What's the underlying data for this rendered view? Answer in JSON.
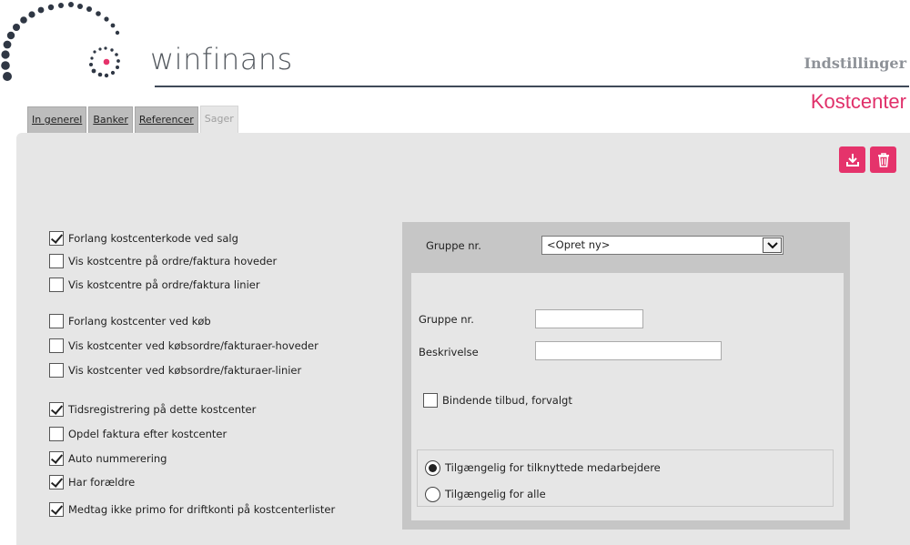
{
  "header": {
    "logo_text": "winfinans",
    "section_title": "Indstillinger",
    "page_title": "Kostcenter"
  },
  "tabs": [
    {
      "label": "In generel",
      "active": false
    },
    {
      "label": "Banker",
      "active": false
    },
    {
      "label": "Referencer",
      "active": false
    },
    {
      "label": "Sager",
      "active": true
    }
  ],
  "toolbar": {
    "save_icon": "download-icon",
    "delete_icon": "trash-icon"
  },
  "settings": [
    {
      "label": "Forlang kostcenterkode ved salg",
      "checked": true
    },
    {
      "label": "Vis kostcentre på ordre/faktura hoveder",
      "checked": false
    },
    {
      "label": "Vis kostcentre på ordre/faktura linier",
      "checked": false
    },
    {
      "label": "Forlang kostcenter ved køb",
      "checked": false
    },
    {
      "label": "Vis kostcenter ved købsordre/fakturaer-hoveder",
      "checked": false
    },
    {
      "label": "Vis kostcenter ved købsordre/fakturaer-linier",
      "checked": false
    },
    {
      "label": "Tidsregistrering på dette kostcenter",
      "checked": true
    },
    {
      "label": "Opdel faktura efter kostcenter",
      "checked": false
    },
    {
      "label": "Auto nummerering",
      "checked": true
    },
    {
      "label": "Har forældre",
      "checked": true
    },
    {
      "label": "Medtag ikke primo for driftkonti på kostcenterlister",
      "checked": true
    }
  ],
  "group": {
    "select_label": "Gruppe nr.",
    "select_value": "<Opret ny>",
    "number_label": "Gruppe nr.",
    "number_value": "",
    "description_label": "Beskrivelse",
    "description_value": "",
    "binding_label": "Bindende tilbud, forvalgt",
    "binding_checked": false,
    "availability": [
      {
        "label": "Tilgængelig for tilknyttede medarbejdere",
        "selected": true
      },
      {
        "label": "Tilgængelig for alle",
        "selected": false
      }
    ]
  },
  "colors": {
    "accent": "#e5336b",
    "header_rule": "#3f4a59",
    "panel_bg": "#e6e6e6"
  }
}
